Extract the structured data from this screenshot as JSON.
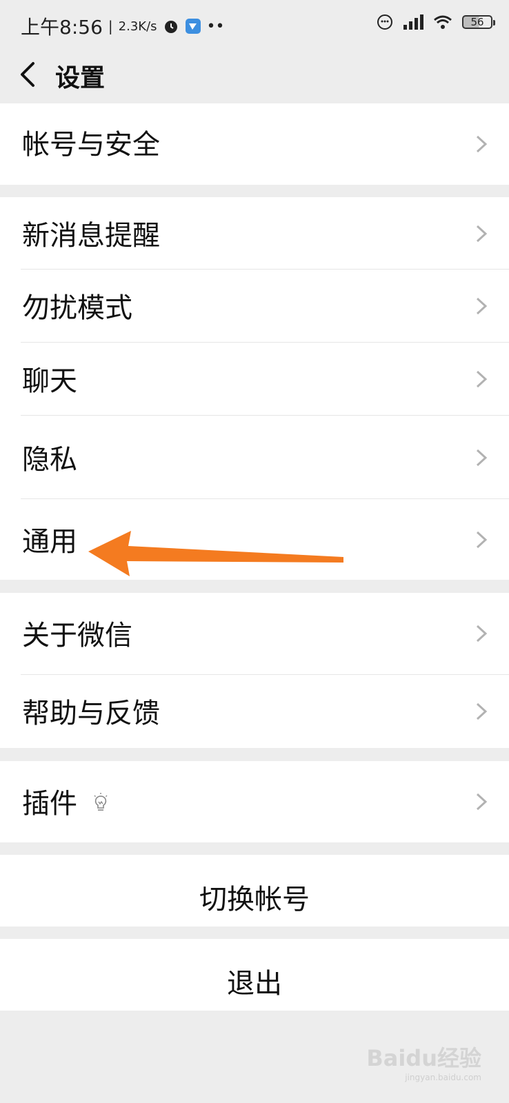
{
  "status_bar": {
    "time": "上午8:56",
    "speed": "2.3K/s",
    "battery": "56",
    "icons": [
      "alarm-icon",
      "app-notification-icon",
      "more-dots-icon",
      "smiley-icon",
      "signal-icon",
      "wifi-icon",
      "battery-icon"
    ]
  },
  "header": {
    "title": "设置"
  },
  "menu": {
    "account_security": "帐号与安全",
    "new_message_alert": "新消息提醒",
    "do_not_disturb": "勿扰模式",
    "chat": "聊天",
    "privacy": "隐私",
    "general": "通用",
    "about": "关于微信",
    "help_feedback": "帮助与反馈",
    "plugins": "插件"
  },
  "actions": {
    "switch_account": "切换帐号",
    "logout": "退出"
  },
  "annotation": {
    "arrow_color": "#f47b20"
  },
  "watermark": {
    "brand": "Baidu经验",
    "url": "jingyan.baidu.com"
  }
}
